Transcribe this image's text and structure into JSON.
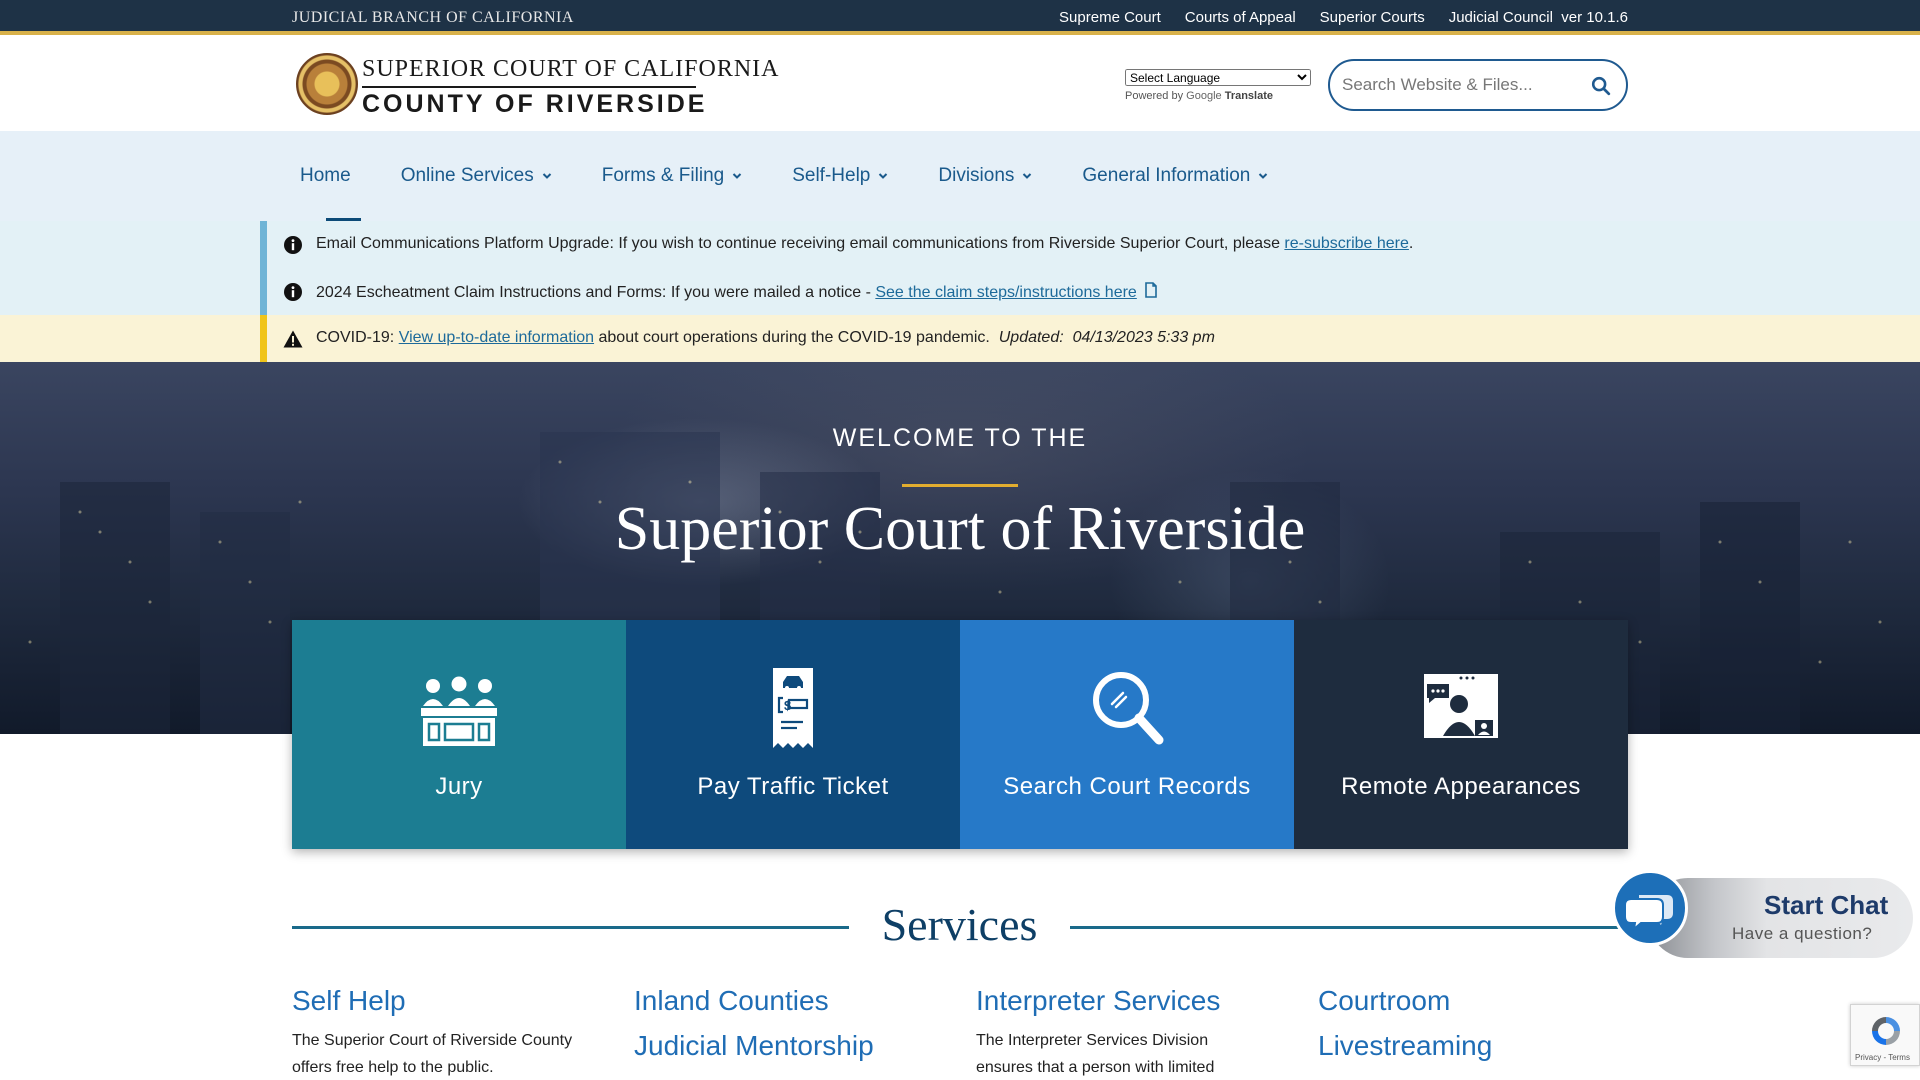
{
  "topbar": {
    "brand": "JUDICIAL BRANCH OF CALIFORNIA",
    "links": [
      "Supreme Court",
      "Courts of Appeal",
      "Superior Courts",
      "Judicial Council"
    ],
    "version": "ver 10.1.6"
  },
  "header": {
    "logo_line1": "SUPERIOR COURT OF CALIFORNIA",
    "logo_line2": "COUNTY OF RIVERSIDE",
    "language_select": "Select Language",
    "powered_by": "Powered by",
    "google": "Google",
    "translate": "Translate",
    "search_placeholder": "Search Website & Files..."
  },
  "nav": {
    "items": [
      {
        "label": "Home",
        "dropdown": false,
        "active": true
      },
      {
        "label": "Online Services",
        "dropdown": true
      },
      {
        "label": "Forms & Filing",
        "dropdown": true
      },
      {
        "label": "Self-Help",
        "dropdown": true
      },
      {
        "label": "Divisions",
        "dropdown": true
      },
      {
        "label": "General Information",
        "dropdown": true
      }
    ]
  },
  "alerts": [
    {
      "type": "info",
      "text": "Email Communications Platform Upgrade: If you wish to continue receiving email communications from Riverside Superior Court, please ",
      "link": "re-subscribe here",
      "after": "."
    },
    {
      "type": "info",
      "text": "2024 Escheatment Claim Instructions and Forms: If you were mailed a notice - ",
      "link": "See the claim steps/instructions here",
      "after": ""
    },
    {
      "type": "warning",
      "text": "COVID-19: ",
      "link": "View up-to-date information",
      "after": " about court operations during the COVID-19 pandemic.",
      "updated_label": "Updated:",
      "updated_value": "04/13/2023 5:33 pm"
    }
  ],
  "hero": {
    "welcome": "WELCOME TO THE",
    "title": "Superior Court of Riverside"
  },
  "tiles": [
    {
      "label": "Jury",
      "icon": "jury-icon",
      "color": "#1c7d92"
    },
    {
      "label": "Pay Traffic Ticket",
      "icon": "traffic-ticket-icon",
      "color": "#0e4a7c"
    },
    {
      "label": "Search Court Records",
      "icon": "search-records-icon",
      "color": "#2679c8"
    },
    {
      "label": "Remote Appearances",
      "icon": "remote-appearance-icon",
      "color": "#1e2c3e"
    }
  ],
  "services": {
    "title": "Services",
    "items": [
      {
        "title": "Self Help",
        "desc": "The Superior Court of Riverside County offers free help to the public."
      },
      {
        "title": "Inland Counties Judicial Mentorship",
        "desc": ""
      },
      {
        "title": "Interpreter Services",
        "desc": "The Interpreter Services Division ensures that a person with limited"
      },
      {
        "title": "Courtroom Livestreaming",
        "desc": ""
      }
    ]
  },
  "chat": {
    "start": "Start Chat",
    "question": "Have a question?"
  },
  "recaptcha": {
    "terms": "Privacy - Terms"
  },
  "colors": {
    "topbar": "#1e3246",
    "accent_gold": "#d8b14a",
    "nav_bg": "#e6f0f8",
    "link": "#1d6a9a",
    "primary_blue": "#1f6db5"
  }
}
